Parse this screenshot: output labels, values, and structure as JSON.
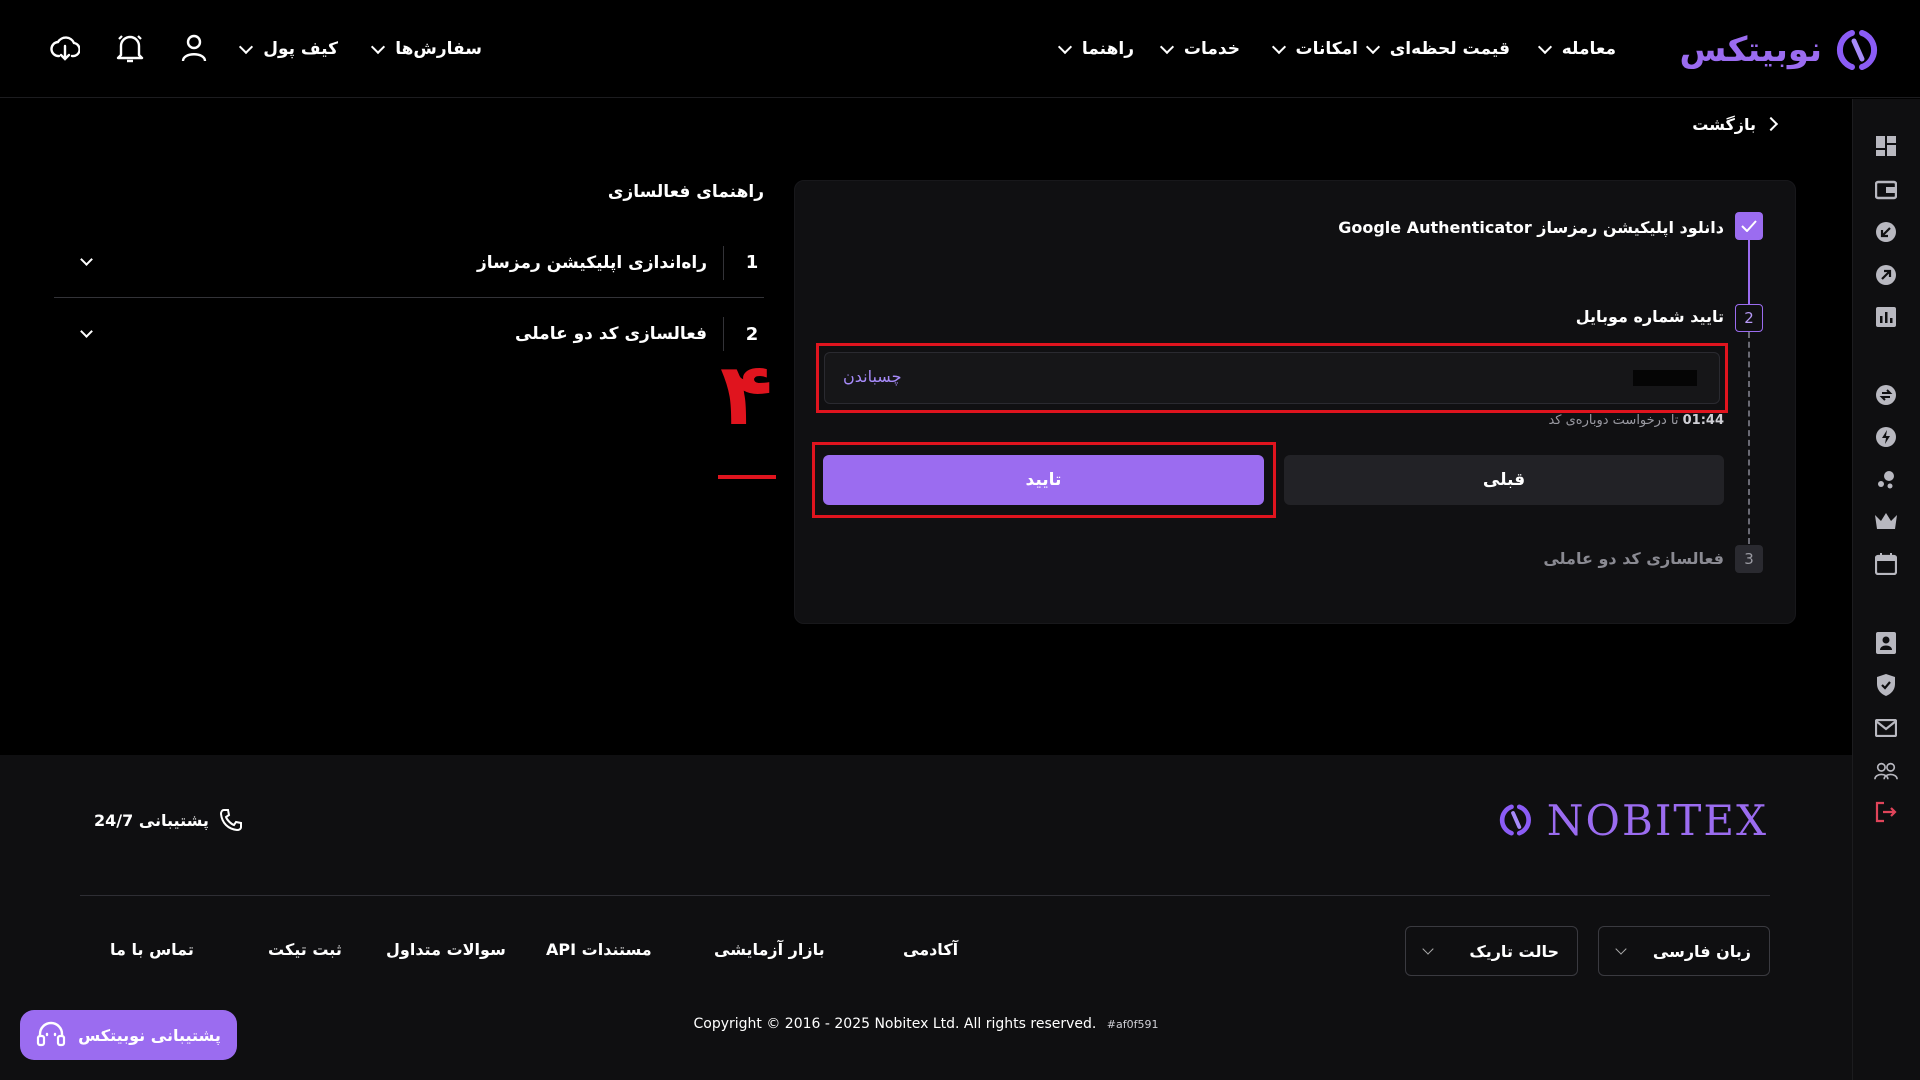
{
  "brand": {
    "logo_text_fa": "نوبیتکس",
    "footer_logo_text": "NOBITEX",
    "accent": "#9b6cf0"
  },
  "header": {
    "nav": [
      {
        "label": "معامله"
      },
      {
        "label": "قیمت لحظه‌ای"
      },
      {
        "label": "امکانات"
      },
      {
        "label": "خدمات"
      },
      {
        "label": "راهنما"
      }
    ],
    "left_nav": [
      {
        "label": "سفارش‌ها"
      },
      {
        "label": "کیف پول"
      }
    ],
    "icons": [
      "user-icon",
      "bell-icon",
      "cloud-download-icon"
    ]
  },
  "back": {
    "label": "بازگشت"
  },
  "wizard": {
    "step1": {
      "number": "1",
      "label": "دانلود اپلیکیشن رمزساز Google Authenticator",
      "done": true
    },
    "step2": {
      "number": "2",
      "label": "تایید شماره موبایل"
    },
    "step3": {
      "number": "3",
      "label": "فعالسازی کد دو عاملی"
    },
    "code_input": {
      "paste_label": "چسباندن"
    },
    "timer": {
      "time": "01:44",
      "text": "تا درخواست دوباره‌ی کد"
    },
    "buttons": {
      "confirm": "تایید",
      "previous": "قبلی"
    }
  },
  "annotation": {
    "number": "۴",
    "color": "#e0141e"
  },
  "guide": {
    "title": "راهنمای فعالسازی",
    "items": [
      {
        "number": "1",
        "label": "راه‌اندازی اپلیکیشن رمزساز"
      },
      {
        "number": "2",
        "label": "فعالسازی کد دو عاملی"
      }
    ]
  },
  "footer": {
    "support_label": "پشتیبانی 24/7",
    "links": [
      "آکادمی",
      "بازار آزمایشی",
      "مستندات API",
      "سوالات متداول",
      "ثبت تیکت",
      "تماس با ما"
    ],
    "language": "زبان فارسی",
    "theme": "حالت تاریک",
    "copyright": "Copyright © 2016 - 2025 Nobitex Ltd. All rights reserved.",
    "build": "#af0f591",
    "support_button": "پشتیبانی نوبیتکس"
  }
}
